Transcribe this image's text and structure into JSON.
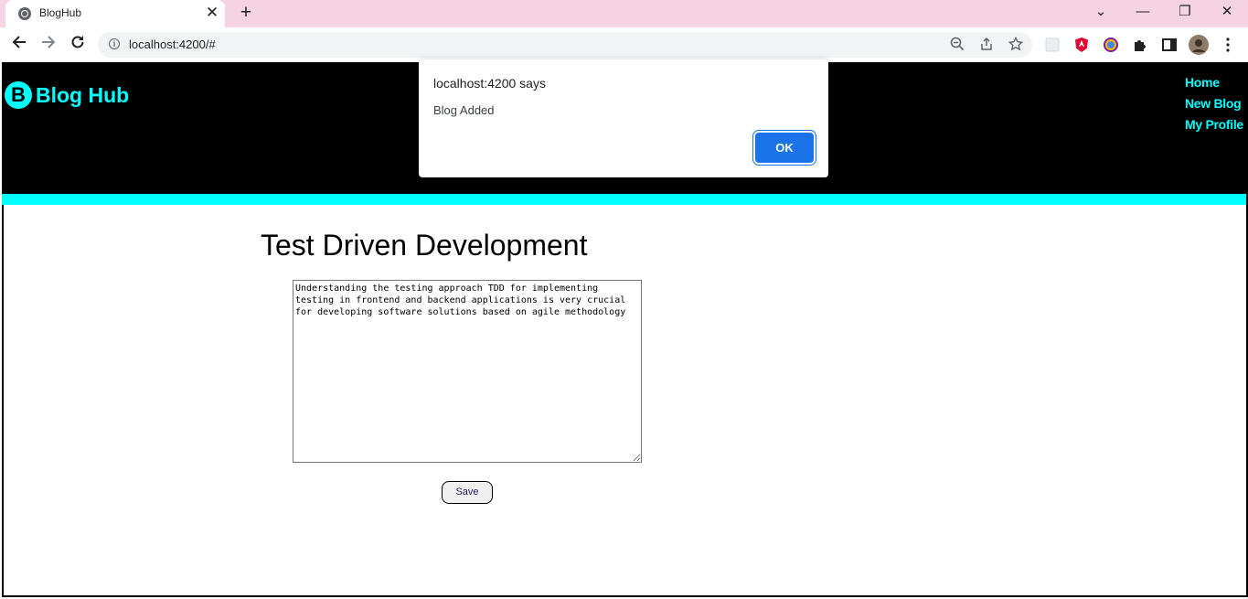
{
  "browser": {
    "tab_title": "BlogHub",
    "tab_close": "✕",
    "new_tab": "+",
    "url": "localhost:4200/#",
    "window_controls": {
      "dropdown": "⌄",
      "minimize": "—",
      "restore": "❐",
      "close": "✕"
    }
  },
  "site": {
    "logo_letter": "B",
    "logo_text": "Blog Hub",
    "nav": [
      "Home",
      "New Blog",
      "My Profile"
    ],
    "colors": {
      "accent": "#00ffff",
      "header": "#000000"
    }
  },
  "blog": {
    "title": "Test Driven Development",
    "body": "Understanding the testing approach TDD for implementing testing in frontend and backend applications is very crucial for developing software solutions based on agile methodology",
    "save_label": "Save"
  },
  "dialog": {
    "title": "localhost:4200 says",
    "message": "Blog Added",
    "ok_label": "OK"
  }
}
